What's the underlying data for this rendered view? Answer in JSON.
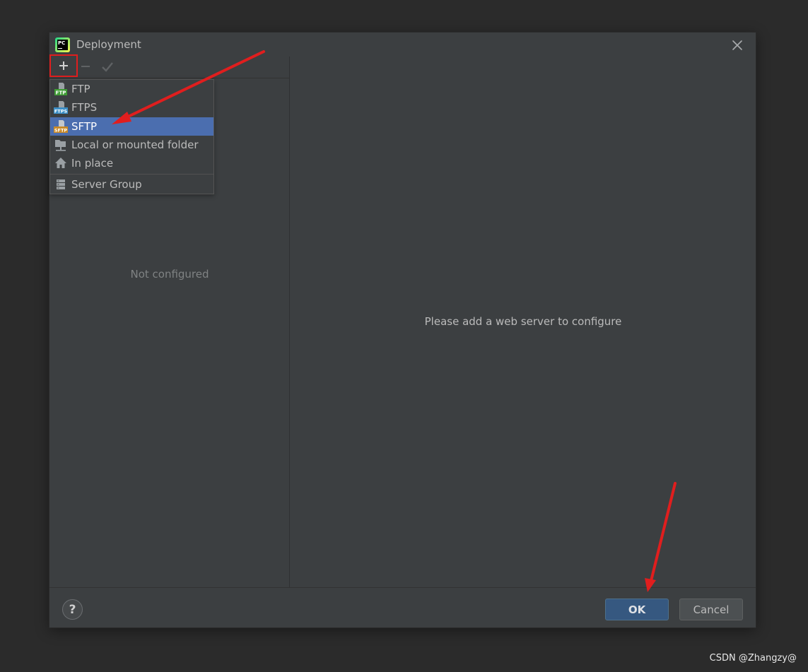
{
  "dialog": {
    "title": "Deployment",
    "app_logo_text": "PC"
  },
  "toolbar": {
    "add_icon": "plus-icon",
    "remove_icon": "minus-icon",
    "apply_icon": "check-icon"
  },
  "left_pane": {
    "empty_text": "Not configured"
  },
  "add_menu": {
    "items": [
      {
        "label": "FTP",
        "icon": "ftp-icon",
        "badge": "FTP",
        "badge_color": "#3f9c35"
      },
      {
        "label": "FTPS",
        "icon": "ftps-icon",
        "badge": "FTPS",
        "badge_color": "#3d8fc6"
      },
      {
        "label": "SFTP",
        "icon": "sftp-icon",
        "badge": "SFTP",
        "badge_color": "#c98b2a",
        "selected": true
      },
      {
        "label": "Local or mounted folder",
        "icon": "folder-icon"
      },
      {
        "label": "In place",
        "icon": "home-icon"
      },
      {
        "label": "Server Group",
        "icon": "server-group-icon"
      }
    ]
  },
  "right_pane": {
    "message": "Please add a web server to configure"
  },
  "footer": {
    "help_label": "?",
    "ok_label": "OK",
    "cancel_label": "Cancel"
  },
  "watermark": "CSDN @Zhangzy@",
  "colors": {
    "dialog_bg": "#3c3f41",
    "selection": "#4b6eaf",
    "ok_button": "#365880",
    "annotation_red": "#e01e1e"
  }
}
